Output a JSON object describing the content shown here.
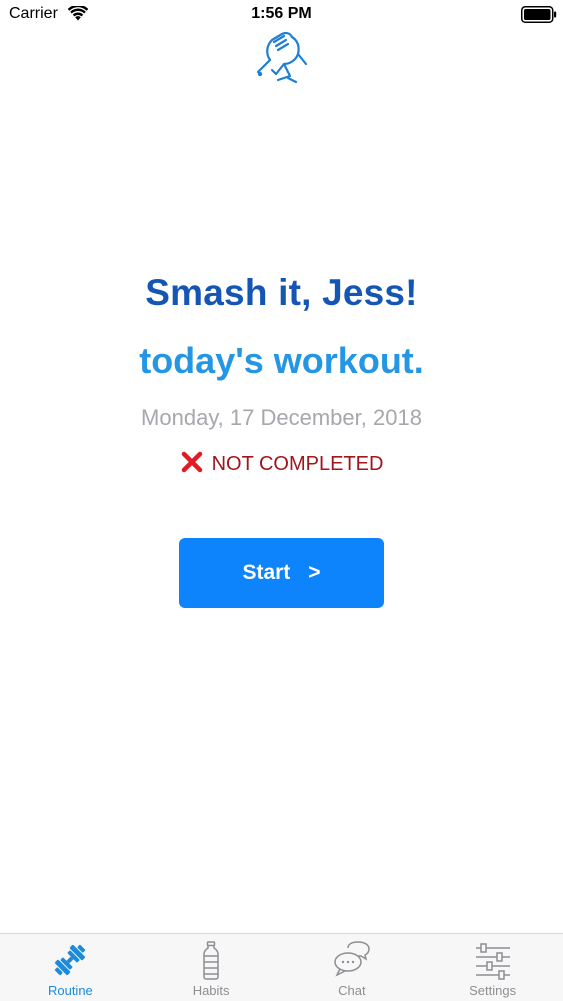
{
  "status_bar": {
    "carrier": "Carrier",
    "time": "1:56 PM"
  },
  "main": {
    "headline": "Smash it, Jess!",
    "subheadline": "today's workout.",
    "date": "Monday, 17 December, 2018",
    "status_text": "NOT COMPLETED",
    "start_label": "Start",
    "start_chevron": ">"
  },
  "tabs": [
    {
      "label": "Routine",
      "icon": "dumbbell-icon",
      "active": true
    },
    {
      "label": "Habits",
      "icon": "water-bottle-icon",
      "active": false
    },
    {
      "label": "Chat",
      "icon": "chat-bubbles-icon",
      "active": false
    },
    {
      "label": "Settings",
      "icon": "sliders-icon",
      "active": false
    }
  ],
  "colors": {
    "headline": "#1556b5",
    "subheadline": "#2596e3",
    "date": "#a7a7ad",
    "status": "#a0161c",
    "button": "#0d84fb",
    "tab_active": "#1f8ad8",
    "tab_inactive": "#8e8e93"
  }
}
